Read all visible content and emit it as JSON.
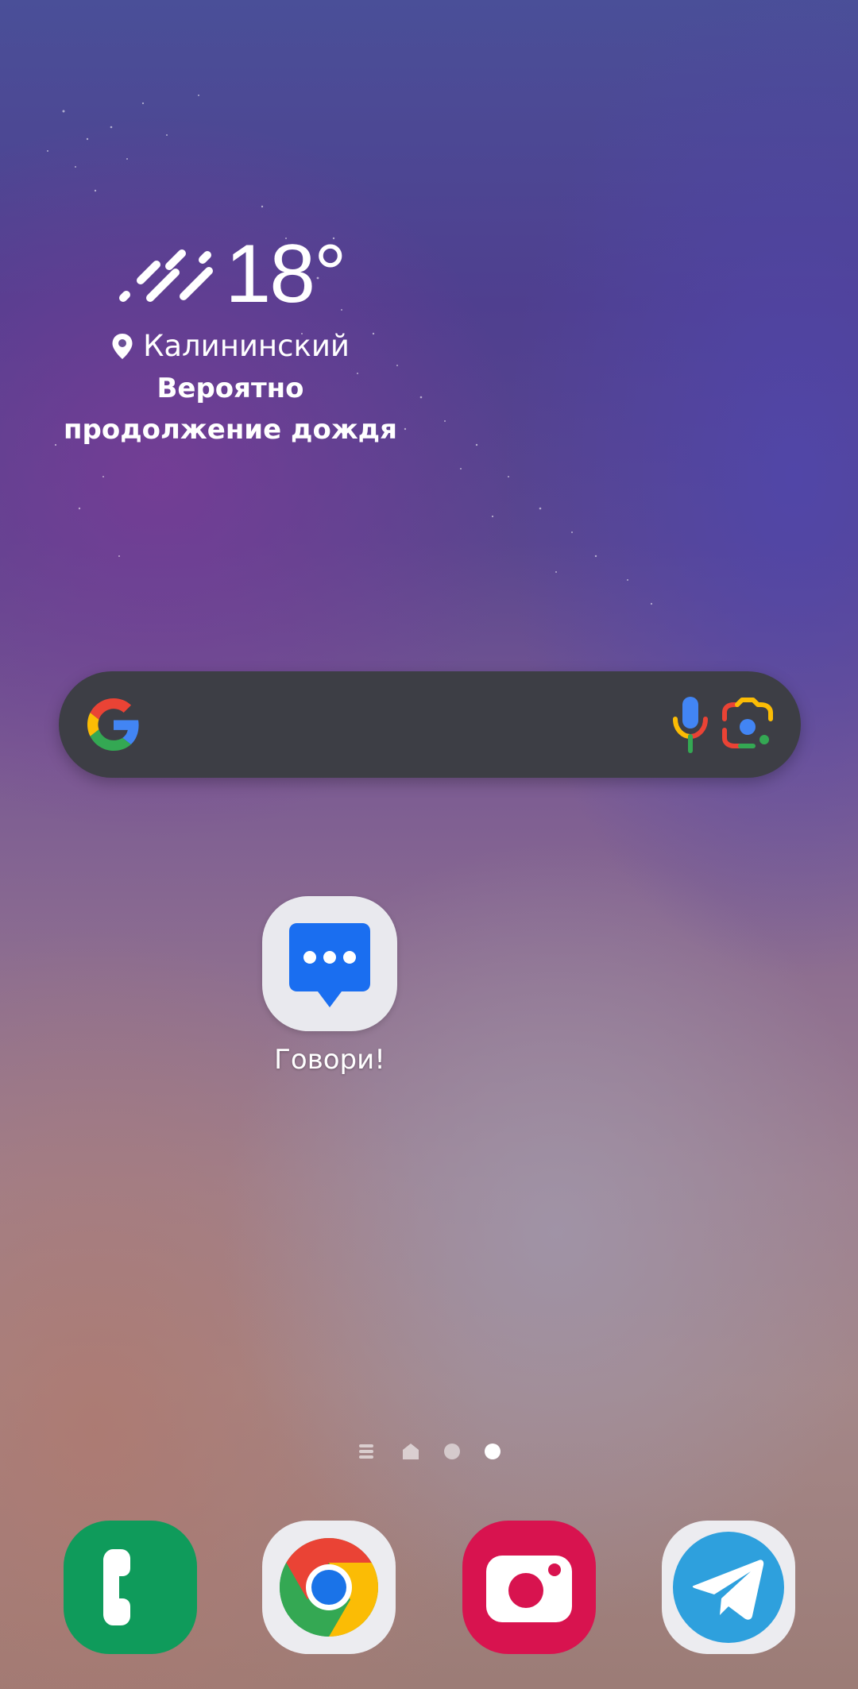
{
  "weather": {
    "temperature": "18°",
    "location": "Калининский",
    "forecast_line1": "Вероятно",
    "forecast_line2": "продолжение дождя",
    "icon": "rain-icon"
  },
  "search": {
    "logo": "google-g-icon",
    "voice_icon": "mic-icon",
    "lens_icon": "google-lens-icon"
  },
  "home_apps": [
    {
      "label": "Говори!",
      "icon": "chat-bubble-icon"
    }
  ],
  "pager": {
    "pages": [
      "menu",
      "home",
      "page-1",
      "page-2"
    ],
    "active_index": 3
  },
  "dock": [
    {
      "icon": "phone-icon",
      "color": "#0f9b5b"
    },
    {
      "icon": "chrome-icon",
      "color": "#ececf0"
    },
    {
      "icon": "camera-icon",
      "color": "#d8134f"
    },
    {
      "icon": "telegram-icon",
      "color": "#ececf0"
    }
  ]
}
